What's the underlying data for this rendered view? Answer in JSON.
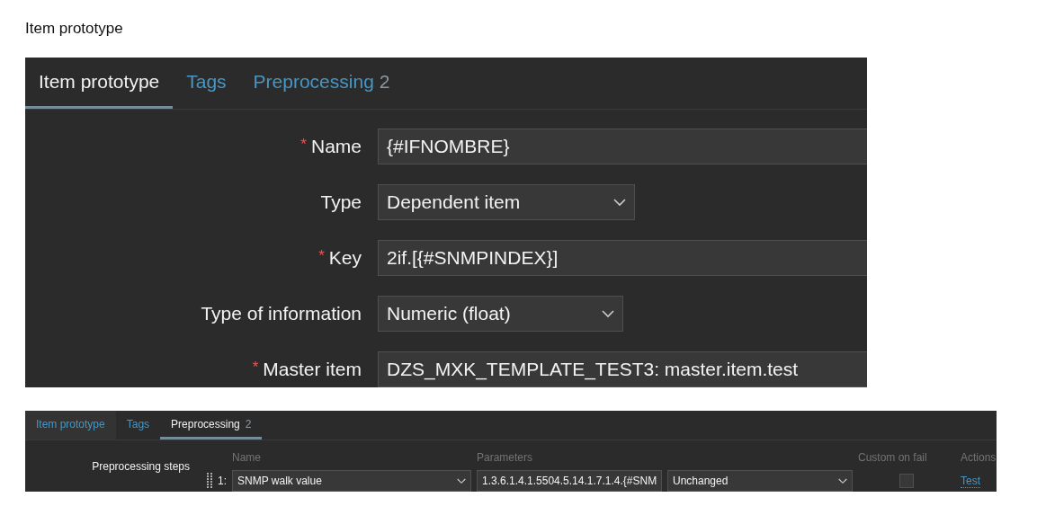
{
  "title": "Item prototype",
  "panels": [
    {
      "kind": "form",
      "tabs": [
        {
          "label": "Item prototype",
          "selected": true
        },
        {
          "label": "Tags",
          "selected": false
        },
        {
          "label": "Preprocessing",
          "count": "2",
          "selected": false
        }
      ],
      "rows": [
        {
          "label": "Name",
          "marker": "*",
          "kind": "text",
          "value": "{#IFNOMBRE}"
        },
        {
          "label": "Type",
          "kind": "select",
          "value": "Dependent item"
        },
        {
          "label": "Key",
          "marker": "*",
          "kind": "text",
          "value": "2if.[{#SNMPINDEX}]"
        },
        {
          "label": "Type of information",
          "kind": "select",
          "value": "Numeric (float)"
        },
        {
          "label": "Master item",
          "marker": "*",
          "kind": "text",
          "value": "DZS_MXK_TEMPLATE_TEST3: master.item.test"
        }
      ]
    },
    {
      "kind": "steps",
      "tabs": [
        {
          "label": "Item prototype",
          "selected": false
        },
        {
          "label": "Tags",
          "selected": false
        },
        {
          "label": "Preprocessing",
          "count": "2",
          "selected": true
        }
      ],
      "label": "Preprocessing steps",
      "columns": [
        "Name",
        "Parameters",
        "Custom on fail",
        "Actions"
      ],
      "steps": [
        {
          "number": "1:",
          "name": "SNMP walk value",
          "parameter": "1.3.6.1.4.1.5504.5.14.1.7.1.4.{#SNM",
          "on_fail": "Unchanged",
          "custom_on_fail": false,
          "actions": [
            "Test"
          ]
        }
      ]
    }
  ]
}
